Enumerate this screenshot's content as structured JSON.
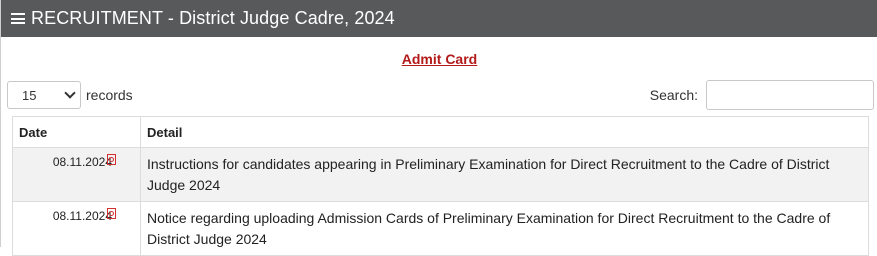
{
  "header": {
    "title": "RECRUITMENT - District Judge Cadre, 2024",
    "icon": "list-icon"
  },
  "admit_card_link": "Admit Card",
  "controls": {
    "page_length": "15",
    "page_length_suffix": "records",
    "search_label": "Search:",
    "search_value": ""
  },
  "table": {
    "headers": [
      "Date",
      "Detail"
    ],
    "rows": [
      {
        "date": "08.11.2024",
        "detail": "Instructions for candidates appearing in Preliminary Examination for Direct Recruitment to the Cadre of District Judge 2024"
      },
      {
        "date": "08.11.2024",
        "detail": "Notice regarding uploading Admission Cards of Preliminary Examination for Direct Recruitment to the Cadre of District Judge 2024"
      }
    ]
  },
  "colors": {
    "header_bg": "#58595b",
    "link": "#b31b1b",
    "pdf_icon": "#d32f2f"
  }
}
